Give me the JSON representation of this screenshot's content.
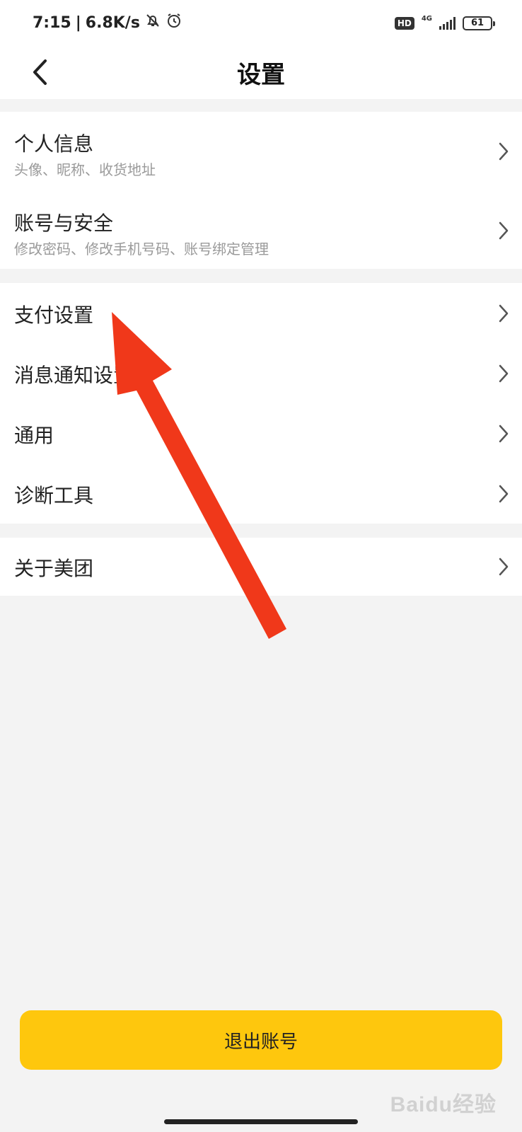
{
  "status_bar": {
    "time": "7:15",
    "speed": "6.8K/s",
    "network": "4G",
    "hd": "HD",
    "battery": "61"
  },
  "header": {
    "title": "设置",
    "back_icon": "chevron-left-icon"
  },
  "groups": [
    {
      "items": [
        {
          "title": "个人信息",
          "subtitle": "头像、昵称、收货地址"
        },
        {
          "title": "账号与安全",
          "subtitle": "修改密码、修改手机号码、账号绑定管理"
        }
      ]
    },
    {
      "items": [
        {
          "title": "支付设置"
        },
        {
          "title": "消息通知设置"
        },
        {
          "title": "通用"
        },
        {
          "title": "诊断工具"
        }
      ]
    },
    {
      "items": [
        {
          "title": "关于美团"
        }
      ]
    }
  ],
  "logout_label": "退出账号",
  "watermark": "Baidu经验",
  "colors": {
    "accent": "#fec70d",
    "background": "#f3f3f3",
    "annotation_arrow": "#f0381a"
  }
}
